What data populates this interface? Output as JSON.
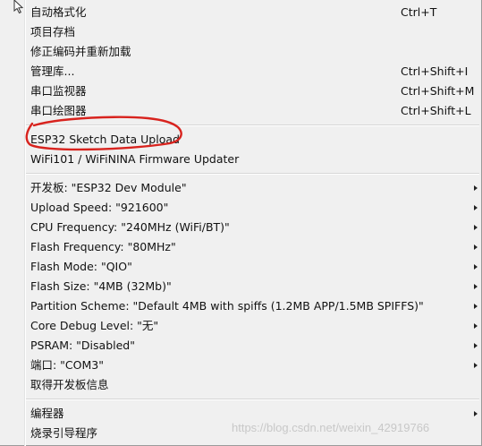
{
  "menu": {
    "items": [
      {
        "label": "自动格式化",
        "shortcut": "Ctrl+T",
        "submenu": false
      },
      {
        "label": "项目存档",
        "shortcut": "",
        "submenu": false
      },
      {
        "label": "修正编码并重新加载",
        "shortcut": "",
        "submenu": false
      },
      {
        "label": "管理库...",
        "shortcut": "Ctrl+Shift+I",
        "submenu": false
      },
      {
        "label": "串口监视器",
        "shortcut": "Ctrl+Shift+M",
        "submenu": false
      },
      {
        "label": "串口绘图器",
        "shortcut": "Ctrl+Shift+L",
        "submenu": false
      },
      {
        "label": "ESP32 Sketch Data Upload",
        "shortcut": "",
        "submenu": false
      },
      {
        "label": "WiFi101 / WiFiNINA Firmware Updater",
        "shortcut": "",
        "submenu": false
      },
      {
        "label": "开发板: \"ESP32 Dev Module\"",
        "shortcut": "",
        "submenu": true
      },
      {
        "label": "Upload Speed: \"921600\"",
        "shortcut": "",
        "submenu": true
      },
      {
        "label": "CPU Frequency: \"240MHz (WiFi/BT)\"",
        "shortcut": "",
        "submenu": true
      },
      {
        "label": "Flash Frequency: \"80MHz\"",
        "shortcut": "",
        "submenu": true
      },
      {
        "label": "Flash Mode: \"QIO\"",
        "shortcut": "",
        "submenu": true
      },
      {
        "label": "Flash Size: \"4MB (32Mb)\"",
        "shortcut": "",
        "submenu": true
      },
      {
        "label": "Partition Scheme: \"Default 4MB with spiffs (1.2MB APP/1.5MB SPIFFS)\"",
        "shortcut": "",
        "submenu": true
      },
      {
        "label": "Core Debug Level: \"无\"",
        "shortcut": "",
        "submenu": true
      },
      {
        "label": "PSRAM: \"Disabled\"",
        "shortcut": "",
        "submenu": true
      },
      {
        "label": "端口: \"COM3\"",
        "shortcut": "",
        "submenu": true
      },
      {
        "label": "取得开发板信息",
        "shortcut": "",
        "submenu": false
      },
      {
        "label": "编程器",
        "shortcut": "",
        "submenu": true
      },
      {
        "label": "烧录引导程序",
        "shortcut": "",
        "submenu": false
      }
    ]
  },
  "annotation": {
    "color": "#d8231e"
  },
  "watermark": {
    "text": "https://blog.csdn.net/weixin_42919766"
  },
  "colors": {
    "menu_bg": "#f0f0f0",
    "text": "#111111",
    "separator": "#d6d6d6"
  }
}
